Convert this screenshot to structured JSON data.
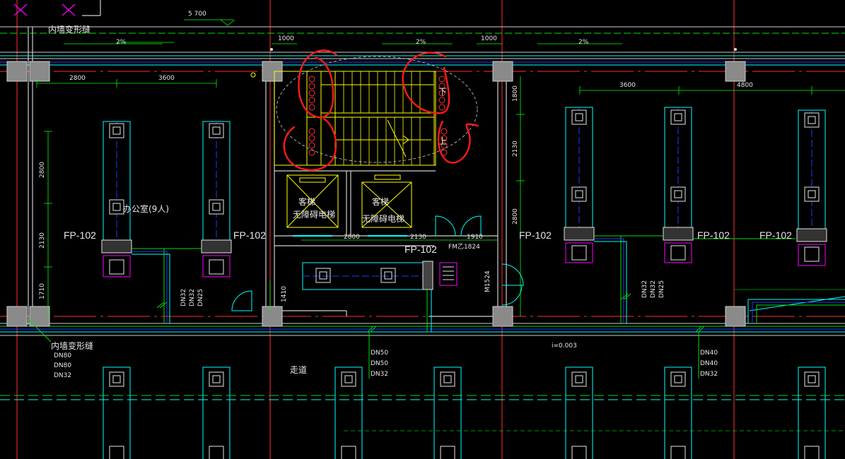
{
  "colors": {
    "background": "#000000",
    "wall": "#cfcfcf",
    "column": "#8a8a8a",
    "dimension": "#00ff00",
    "duct": "#00ffff",
    "stair": "#ffff00",
    "axis": "#ff3030",
    "pipe_green": "#00e000",
    "pipe_blue": "#1e3cff",
    "grille": "#ff00ff",
    "markup": "#ff1a1a",
    "text": "#e6e6e6"
  },
  "dimensions": {
    "top_total": "5 700",
    "top_left_1": "1000",
    "top_right_1": "1000",
    "room_w_1": "2800",
    "room_w_2": "3600",
    "room_w_3": "3600",
    "room_w_4": "4800",
    "left_h_1": "2800",
    "left_h_2": "2130",
    "left_h_3": "1710",
    "stair_h_1": "1800",
    "stair_h_2": "2130",
    "stair_h_3": "2800",
    "lift_w_1": "2800",
    "lift_w_2": "2130",
    "door_w": "1910",
    "small_h": "1410"
  },
  "slopes": {
    "s1": "2%",
    "s2": "2%",
    "s3": "2%",
    "corridor_slope": "i=0.003"
  },
  "labels": {
    "wall_joint_top": "内墙变形缝",
    "wall_joint_bottom": "内墙变形缝",
    "office": "办公室(9人)",
    "corridor": "走道",
    "stair_down": "下",
    "stair_up": "上",
    "lift1_a": "客梯",
    "lift1_b": "无障碍电梯",
    "lift2_a": "客梯",
    "lift2_b": "无障碍电梯",
    "fire_door": "FM乙1824",
    "door_tag": "M1524"
  },
  "fan_coil_labels": [
    "FP-102",
    "FP-102",
    "FP-102",
    "FP-102",
    "FP-102",
    "FP-102"
  ],
  "pipe_labels": {
    "left_group": [
      "DN32",
      "DN32",
      "DN25"
    ],
    "right_group": [
      "DN32",
      "DN32",
      "DN25"
    ],
    "wall_group": [
      "DN80",
      "DN80",
      "DN32"
    ],
    "mid_group": [
      "DN50",
      "DN50",
      "DN32"
    ],
    "east_group": [
      "DN40",
      "DN40",
      "DN32"
    ]
  }
}
